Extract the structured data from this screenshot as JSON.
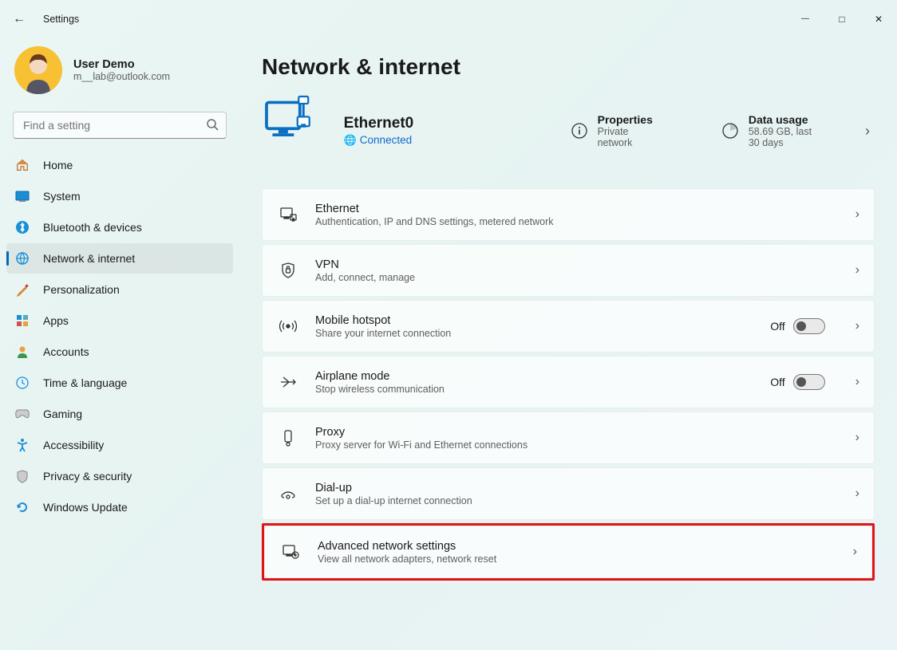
{
  "window": {
    "title": "Settings",
    "min": "—",
    "max": "▢",
    "close": "✕"
  },
  "user": {
    "name": "User Demo",
    "email": "m__lab@outlook.com"
  },
  "search": {
    "placeholder": "Find a setting"
  },
  "nav": {
    "home": "Home",
    "system": "System",
    "bluetooth": "Bluetooth & devices",
    "network": "Network & internet",
    "personalization": "Personalization",
    "apps": "Apps",
    "accounts": "Accounts",
    "time": "Time & language",
    "gaming": "Gaming",
    "accessibility": "Accessibility",
    "privacy": "Privacy & security",
    "update": "Windows Update"
  },
  "page": {
    "title": "Network & internet"
  },
  "hero": {
    "name": "Ethernet0",
    "status": "Connected",
    "properties": {
      "title": "Properties",
      "desc": "Private network"
    },
    "usage": {
      "title": "Data usage",
      "desc": "58.69 GB, last 30 days"
    }
  },
  "cards": {
    "ethernet": {
      "title": "Ethernet",
      "desc": "Authentication, IP and DNS settings, metered network"
    },
    "vpn": {
      "title": "VPN",
      "desc": "Add, connect, manage"
    },
    "hotspot": {
      "title": "Mobile hotspot",
      "desc": "Share your internet connection",
      "toggle": "Off"
    },
    "airplane": {
      "title": "Airplane mode",
      "desc": "Stop wireless communication",
      "toggle": "Off"
    },
    "proxy": {
      "title": "Proxy",
      "desc": "Proxy server for Wi-Fi and Ethernet connections"
    },
    "dialup": {
      "title": "Dial-up",
      "desc": "Set up a dial-up internet connection"
    },
    "advanced": {
      "title": "Advanced network settings",
      "desc": "View all network adapters, network reset"
    }
  }
}
